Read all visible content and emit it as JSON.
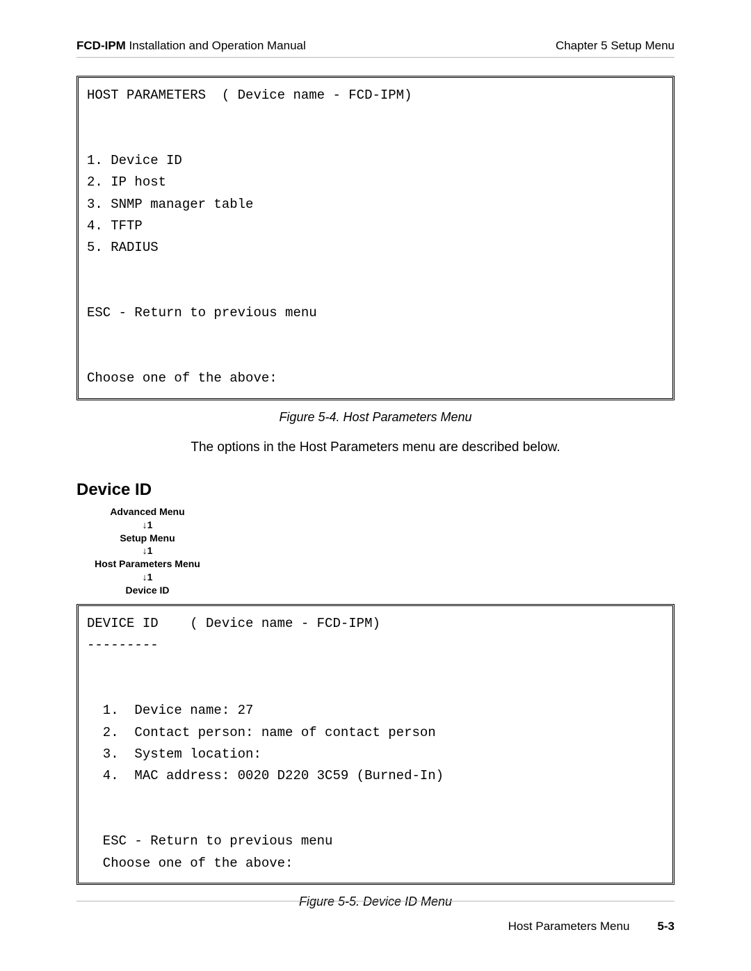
{
  "header": {
    "left_bold": "FCD-IPM",
    "left_rest": " Installation and Operation Manual",
    "right": "Chapter 5  Setup Menu"
  },
  "terminal1": {
    "title": "HOST PARAMETERS  ( Device name - FCD-IPM)",
    "item1": "1. Device ID",
    "item2": "2. IP host",
    "item3": "3. SNMP manager table",
    "item4": "4. TFTP",
    "item5": "5. RADIUS",
    "esc": "ESC - Return to previous menu",
    "choose": "Choose one of the above:"
  },
  "caption1": "Figure 5-4.  Host Parameters Menu",
  "intro": "The options in the Host Parameters menu are described below.",
  "section_heading": "Device ID",
  "nav": {
    "l1": "Advanced Menu",
    "a1": "↓1",
    "l2": "Setup Menu",
    "a2": "↓1",
    "l3": "Host Parameters Menu",
    "a3": "↓1",
    "l4": "Device ID"
  },
  "terminal2": {
    "title": "DEVICE ID    ( Device name - FCD-IPM)",
    "dash": "---------",
    "item1": "  1.  Device name: 27",
    "item2": "  2.  Contact person: name of contact person",
    "item3": "  3.  System location:",
    "item4": "  4.  MAC address: 0020 D220 3C59 (Burned-In)",
    "esc": "  ESC - Return to previous menu",
    "choose": "  Choose one of the above:"
  },
  "caption2": "Figure 5-5.  Device ID Menu",
  "footer": {
    "title": "Host Parameters Menu",
    "page": "5-3"
  }
}
